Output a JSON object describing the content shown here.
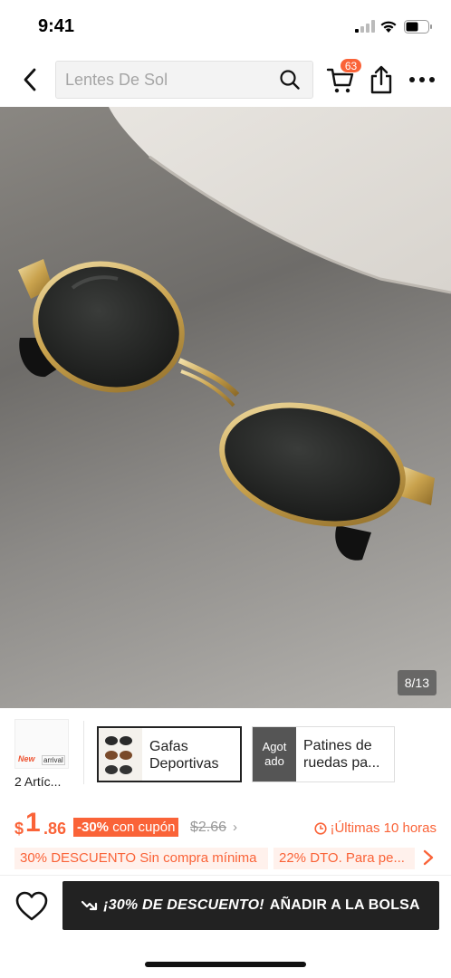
{
  "status_bar": {
    "time": "9:41"
  },
  "search": {
    "placeholder": "Lentes De Sol"
  },
  "cart": {
    "badge_count": "63"
  },
  "gallery": {
    "counter": "8/13"
  },
  "related": {
    "thumb_badge_new": "New",
    "thumb_badge_arrival": "arrival",
    "label": "2 Artíc..."
  },
  "categories": [
    {
      "label": "Gafas Deportivas",
      "selected": true
    },
    {
      "label_icon": "Agot ado",
      "label": "Patines de ruedas pa...",
      "selected": false
    }
  ],
  "price": {
    "currency": "$",
    "integer": "1",
    "decimal": ".86",
    "discount": "-30%",
    "discount_suffix": "con cupón",
    "original": "$2.66",
    "urgency": "¡Últimas 10 horas"
  },
  "promos": [
    "30% DESCUENTO Sin compra mínima",
    "22% DTO. Para pe..."
  ],
  "cta": {
    "promo": "¡30% DE DESCUENTO!",
    "label": "AÑADIR A LA BOLSA"
  },
  "colors": {
    "accent": "#fa6338",
    "cta_bg": "#222222"
  },
  "icons": [
    "back-arrow-icon",
    "search-icon",
    "cart-icon",
    "share-icon",
    "more-icon",
    "clock-icon",
    "chevron-right-icon",
    "heart-icon",
    "trend-down-icon"
  ]
}
